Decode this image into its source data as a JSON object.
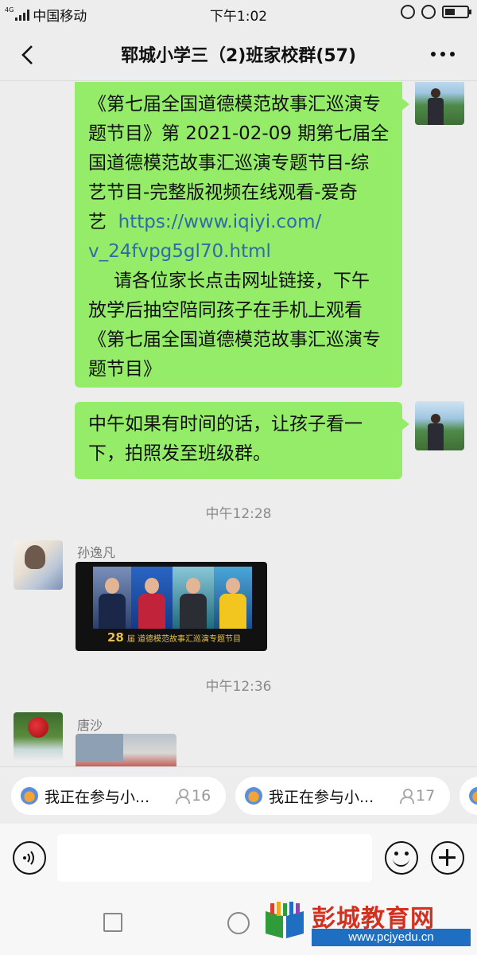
{
  "status_bar": {
    "network": "4G",
    "carrier": "中国移动",
    "time": "下午1:02",
    "battery_level": 0.45
  },
  "header": {
    "title": "郓城小学三（2)班家校群(57)",
    "back_icon": "chevron-left-icon",
    "more_icon": "more-icon"
  },
  "messages": [
    {
      "direction": "out",
      "lines": {
        "l1": "《第七届全国道德模范故事汇巡演专",
        "l2": "题节目》第 2021-02-09 期第七届全",
        "l3": "国道德模范故事汇巡演专题节目-综",
        "l4": "艺节目-完整版视频在线观看-爱奇",
        "l5_text": "艺",
        "l5_link": "https://www.iqiyi.com/",
        "l6_link": "v_24fvpg5gl70.html",
        "l7": "请各位家长点击网址链接，下午",
        "l8": "放学后抽空陪同孩子在手机上观看",
        "l9": "《第七届全国道德模范故事汇巡演专",
        "l10": "题节目》"
      }
    },
    {
      "direction": "out",
      "lines": {
        "l1": "中午如果有时间的话，让孩子看一",
        "l2": "下，拍照发至班级群。"
      }
    },
    {
      "direction": "time",
      "time": "中午12:28"
    },
    {
      "direction": "in",
      "sender": "孙逸凡",
      "type": "video",
      "caption_number": "28",
      "caption_text": "届 道德模范故事汇巡演专题节目"
    },
    {
      "direction": "time",
      "time": "中午12:36"
    },
    {
      "direction": "in",
      "sender": "唐沙",
      "type": "image"
    }
  ],
  "mini_programs": [
    {
      "label": "我正在参与小...",
      "count": "16"
    },
    {
      "label": "我正在参与小...",
      "count": "17"
    }
  ],
  "input": {
    "placeholder": "",
    "voice_icon": "voice-icon",
    "emoji_icon": "emoji-icon",
    "plus_icon": "plus-icon"
  },
  "watermark": {
    "title": "彭城教育网",
    "url": "www.pcjyedu.cn"
  },
  "colors": {
    "bubble_out": "#95ec69",
    "link": "#2e6ba7",
    "background": "#ededed"
  }
}
